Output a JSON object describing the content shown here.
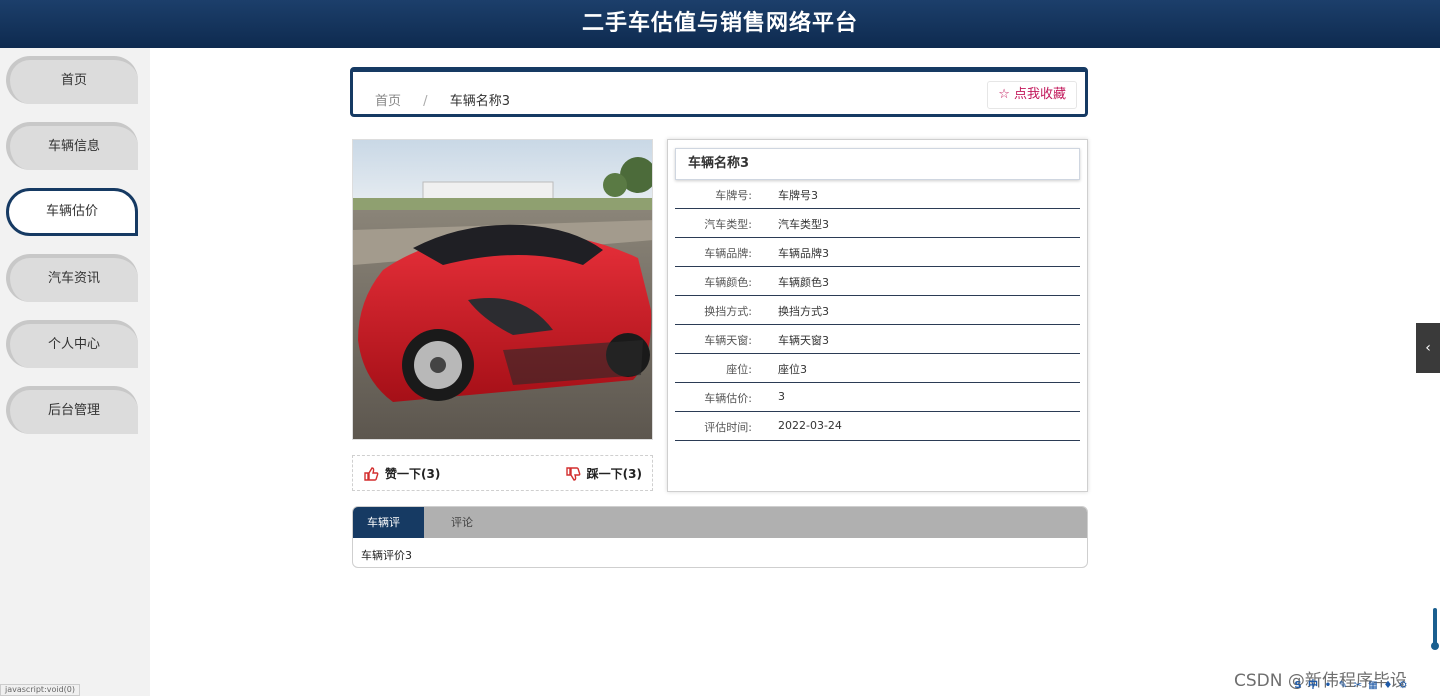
{
  "header": {
    "title": "二手车估值与销售网络平台"
  },
  "sidebar": {
    "items": [
      {
        "label": "首页"
      },
      {
        "label": "车辆信息"
      },
      {
        "label": "车辆估价"
      },
      {
        "label": "汽车资讯"
      },
      {
        "label": "个人中心"
      },
      {
        "label": "后台管理"
      }
    ],
    "active_index": 2
  },
  "breadcrumb": {
    "home": "首页",
    "separator": "/",
    "current": "车辆名称3"
  },
  "favorite": {
    "icon": "star-outline-icon",
    "label": "点我收藏"
  },
  "vote": {
    "like": "赞一下(3)",
    "dislike": "踩一下(3)"
  },
  "details": {
    "title": "车辆名称3",
    "rows": [
      {
        "key": "车牌号:",
        "value": "车牌号3"
      },
      {
        "key": "汽车类型:",
        "value": "汽车类型3"
      },
      {
        "key": "车辆品牌:",
        "value": "车辆品牌3"
      },
      {
        "key": "车辆颜色:",
        "value": "车辆颜色3"
      },
      {
        "key": "换挡方式:",
        "value": "换挡方式3"
      },
      {
        "key": "车辆天窗:",
        "value": "车辆天窗3"
      },
      {
        "key": "座位:",
        "value": "座位3"
      },
      {
        "key": "车辆估价:",
        "value": "3"
      },
      {
        "key": "评估时间:",
        "value": "2022-03-24"
      }
    ]
  },
  "tabs": {
    "items": [
      {
        "label": "车辆评价"
      },
      {
        "label": "评论"
      }
    ],
    "content": "车辆评价3"
  },
  "statusbar": {
    "link": "javascript:void(0)"
  },
  "watermark": "CSDN @新伟程序毕设",
  "colors": {
    "primary": "#163a63",
    "header": "#1c3f6b",
    "like": "#d32f2f"
  }
}
